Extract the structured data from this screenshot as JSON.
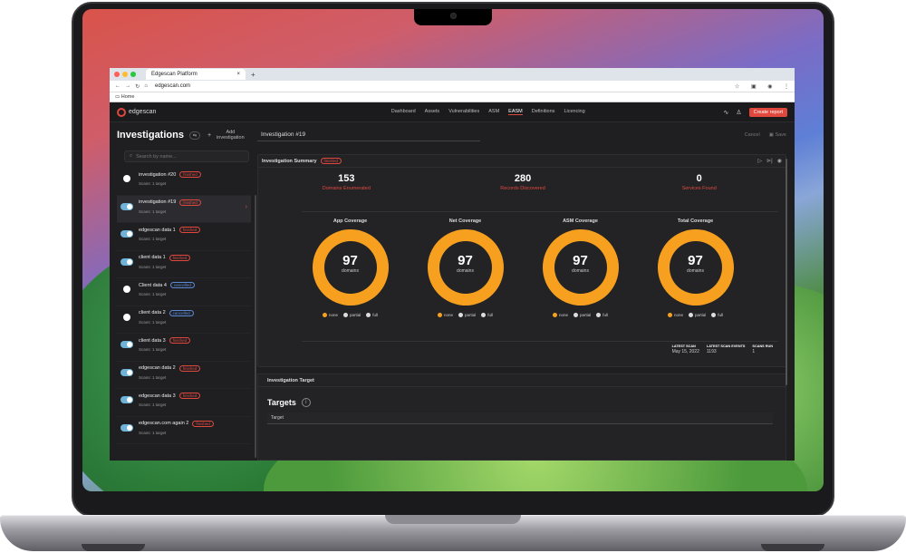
{
  "browser": {
    "tab_title": "Edgescan Platform",
    "url": "edgescan.com",
    "bookmark": "Home"
  },
  "app": {
    "brand": "edgescan",
    "nav": [
      "Dashboard",
      "Assets",
      "Vulnerabilities",
      "ASM",
      "EASM",
      "Definitions",
      "Licencing"
    ],
    "active_nav": "EASM",
    "cta": "Create report"
  },
  "sidebar": {
    "title": "Investigations",
    "add_label_1": "Add",
    "add_label_2": "investigation",
    "search_placeholder": "Search by name...",
    "items": [
      {
        "name": "investigation #20",
        "status": "finished",
        "sub": "Scans: 1 target"
      },
      {
        "name": "investigation #19",
        "status": "finished",
        "sub": "Scans: 1 target"
      },
      {
        "name": "edgescan data 1",
        "status": "finished",
        "sub": "Scans: 1 target"
      },
      {
        "name": "client data 1",
        "status": "finished",
        "sub": "Scans: 1 target"
      },
      {
        "name": "Client data 4",
        "status": "cancelled",
        "sub": "Scans: 1 target"
      },
      {
        "name": "client data 2",
        "status": "cancelled",
        "sub": "Scans: 1 target"
      },
      {
        "name": "client data 3",
        "status": "finished",
        "sub": "Scans: 1 target"
      },
      {
        "name": "edgescan data 2",
        "status": "finished",
        "sub": "Scans: 1 target"
      },
      {
        "name": "edgescan data 3",
        "status": "finished",
        "sub": "Scans: 1 target"
      },
      {
        "name": "edgescan.com again 2",
        "status": "finished",
        "sub": "Scans: 1 target"
      }
    ]
  },
  "main": {
    "investigation_name": "Investigation #19",
    "cancel": "Cancel",
    "save": "Save",
    "summary_title": "Investigation Summary",
    "summary_status": "finished",
    "stats": [
      {
        "value": "153",
        "label": "Domains Enumerated"
      },
      {
        "value": "280",
        "label": "Records Discovered"
      },
      {
        "value": "0",
        "label": "Services Found"
      }
    ],
    "coverage": [
      {
        "title": "App Coverage",
        "value": "97",
        "unit": "domains"
      },
      {
        "title": "Net Coverage",
        "value": "97",
        "unit": "domains"
      },
      {
        "title": "ASM Coverage",
        "value": "97",
        "unit": "domains"
      },
      {
        "title": "Total Coverage",
        "value": "97",
        "unit": "domains"
      }
    ],
    "legend": [
      "none",
      "partial",
      "full"
    ],
    "legend_colors": [
      "#f7a01f",
      "#dddddd",
      "#dddddd"
    ],
    "meta": [
      {
        "head": "LATEST SCAN",
        "value": "May 15, 2022"
      },
      {
        "head": "LATEST SCAN EVENTS",
        "value": "1193"
      },
      {
        "head": "SCANS RUN",
        "value": "1"
      }
    ],
    "target_section": "Investigation Target",
    "targets_title": "Targets",
    "target_col": "Target"
  }
}
